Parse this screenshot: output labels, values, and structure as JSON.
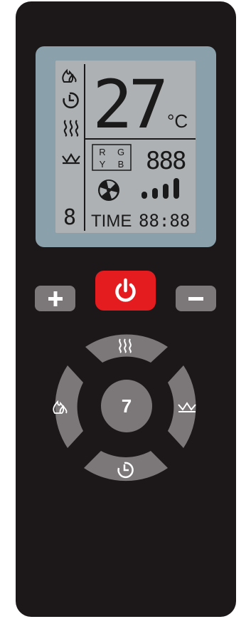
{
  "lcd": {
    "temperature": "27",
    "temperature_unit": "°C",
    "color_labels": [
      "R",
      "G",
      "Y",
      "B"
    ],
    "segment_display": "888",
    "mode_digit": "8",
    "time_label": "TIME",
    "time_value": "88:88",
    "icons": [
      "flame-icon",
      "timer-icon",
      "heat-icon",
      "crown-icon",
      "fan-icon",
      "signal-bars-icon"
    ]
  },
  "buttons": {
    "plus_icon": "plus-icon",
    "minus_icon": "minus-icon",
    "power_icon": "power-icon",
    "heat_icon": "heat-icon",
    "flame_icon": "flame-icon",
    "crown_icon": "crown-icon",
    "timer_icon": "timer-icon",
    "center_label": "7"
  },
  "colors": {
    "body": "#1c1819",
    "lcd_frame": "#8aa1ab",
    "lcd_screen": "#aeb1b3",
    "button_gray": "#7c7778",
    "power_red": "#e51c1f"
  }
}
